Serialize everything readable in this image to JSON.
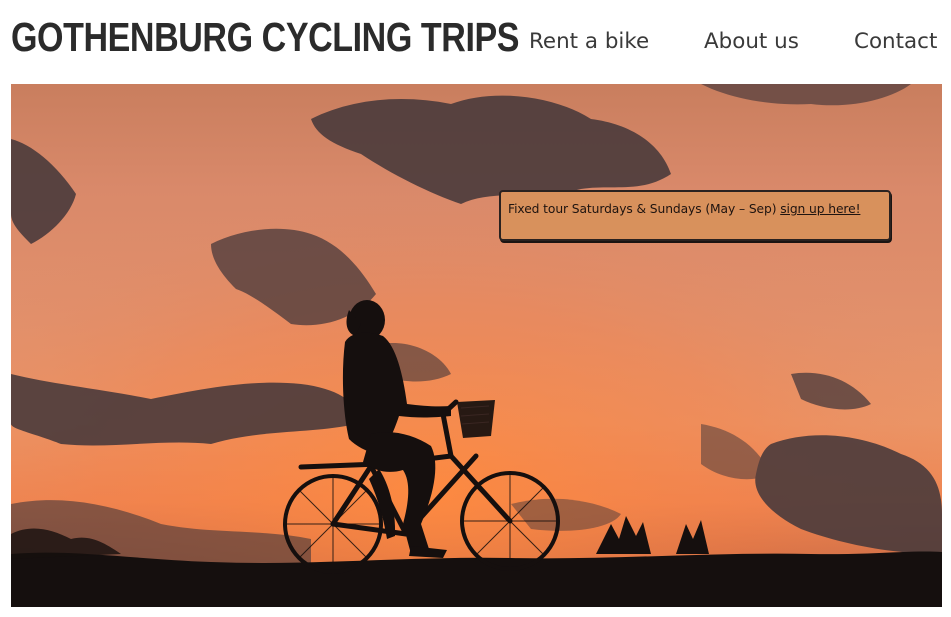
{
  "header": {
    "brand": "GOTHENBURG CYCLING TRIPS",
    "nav": [
      {
        "label": "Rent a bike"
      },
      {
        "label": "About us"
      },
      {
        "label": "Contact"
      }
    ]
  },
  "hero": {
    "image_subject": "silhouette of cyclist riding a bicycle with basket against an orange sunset sky",
    "notice": {
      "text": "Fixed tour Saturdays & Sundays (May – Sep)",
      "link": "sign up here!"
    }
  },
  "colors": {
    "brand_text": "#2b2b2b",
    "nav_text": "#3a3a3a",
    "sky": "#e2906b",
    "notice_bg": "#d8915c",
    "silhouette": "#150f0e"
  },
  "icons": {
    "hero_image": "cyclist-sunset-photo"
  }
}
